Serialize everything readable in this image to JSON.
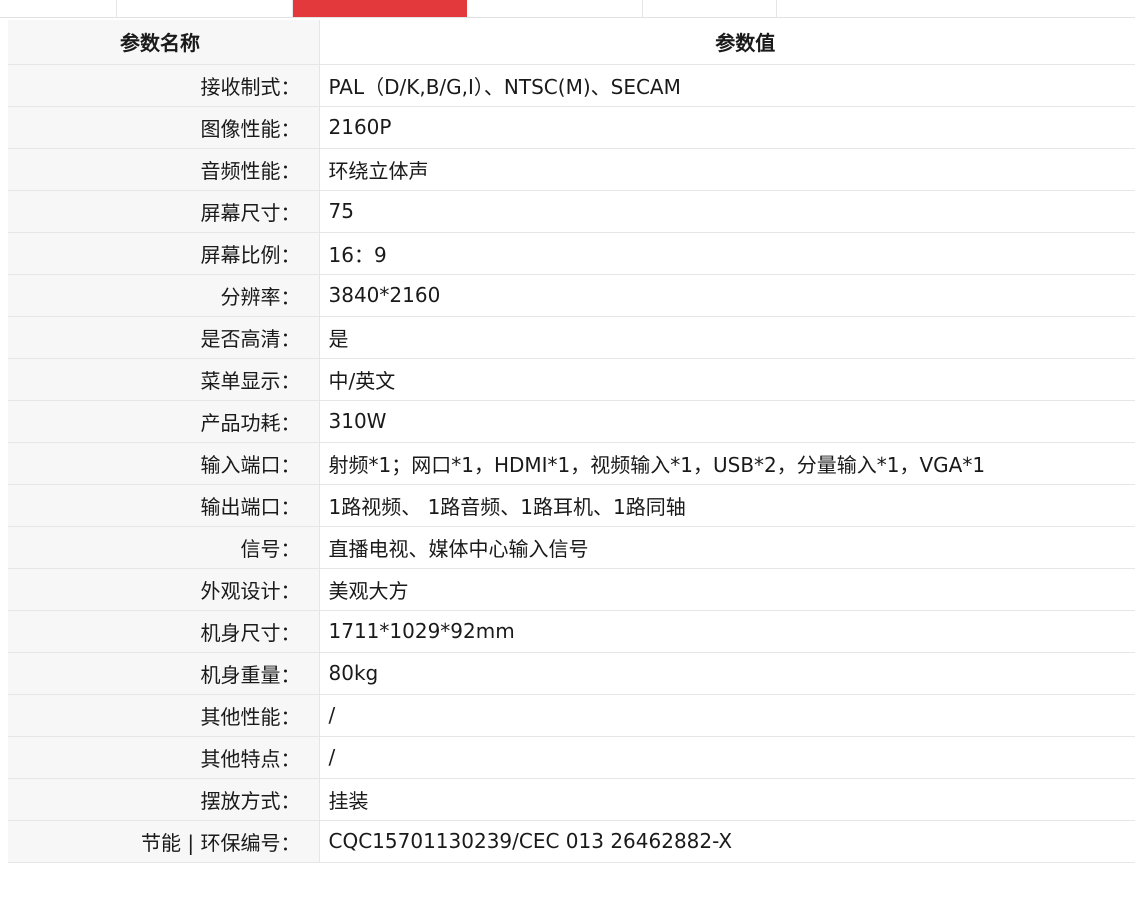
{
  "header": {
    "name_label": "参数名称",
    "value_label": "参数值"
  },
  "tabs": {
    "active_color": "#e4393c"
  },
  "specs": [
    {
      "name": "接收制式：",
      "value": "PAL（D/K,B/G,I）、NTSC(M)、SECAM"
    },
    {
      "name": "图像性能：",
      "value": "2160P"
    },
    {
      "name": "音频性能：",
      "value": "环绕立体声"
    },
    {
      "name": "屏幕尺寸：",
      "value": "75"
    },
    {
      "name": "屏幕比例：",
      "value": "16：9"
    },
    {
      "name": "分辨率：",
      "value": "3840*2160"
    },
    {
      "name": "是否高清：",
      "value": "是"
    },
    {
      "name": "菜单显示：",
      "value": "中/英文"
    },
    {
      "name": "产品功耗：",
      "value": "310W"
    },
    {
      "name": "输入端口：",
      "value": "射频*1；网口*1，HDMI*1，视频输入*1，USB*2，分量输入*1，VGA*1"
    },
    {
      "name": "输出端口：",
      "value": "1路视频、 1路音频、1路耳机、1路同轴"
    },
    {
      "name": "信号：",
      "value": "直播电视、媒体中心输入信号"
    },
    {
      "name": "外观设计：",
      "value": "美观大方"
    },
    {
      "name": "机身尺寸：",
      "value": "1711*1029*92mm"
    },
    {
      "name": "机身重量：",
      "value": "80kg"
    },
    {
      "name": "其他性能：",
      "value": "/"
    },
    {
      "name": "其他特点：",
      "value": "/"
    },
    {
      "name": "摆放方式：",
      "value": "挂装"
    },
    {
      "name": "节能 | 环保编号：",
      "value": "CQC15701130239/CEC 013 26462882-X"
    }
  ]
}
